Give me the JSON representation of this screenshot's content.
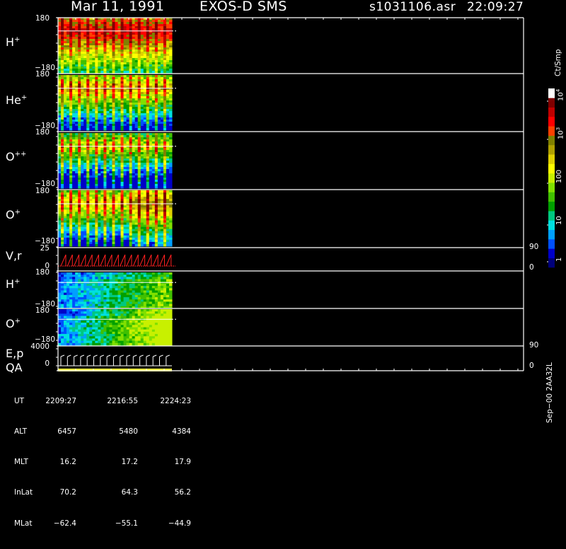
{
  "header": {
    "date": "Mar 11, 1991",
    "instrument": "EXOS-D SMS",
    "filename": "s1031106.asr",
    "time": "22:09:27"
  },
  "panels": [
    {
      "label": "H",
      "sup": "+",
      "top_tick": "180",
      "bottom_tick": "−180"
    },
    {
      "label": "He",
      "sup": "+",
      "top_tick": "180",
      "bottom_tick": "−180"
    },
    {
      "label": "O",
      "sup": "++",
      "top_tick": "180",
      "bottom_tick": "−180"
    },
    {
      "label": "O",
      "sup": "+",
      "top_tick": "180",
      "bottom_tick": "−180"
    }
  ],
  "vr_panel": {
    "label": "V,r",
    "top_tick": "25",
    "bottom_tick": "0",
    "right_top": "90",
    "right_bottom": "0"
  },
  "lower_panels": [
    {
      "label": "H",
      "sup": "+",
      "top_tick": "180",
      "bottom_tick": "−180"
    },
    {
      "label": "O",
      "sup": "+",
      "top_tick": "180",
      "bottom_tick": "−180"
    }
  ],
  "ep_panel": {
    "label1": "E,p",
    "label2": "QA",
    "top_tick": "4000",
    "bottom_tick": "0",
    "right_top": "90",
    "right_bottom": "0"
  },
  "colorbar": {
    "unit": "Ct/Smp",
    "ticks": [
      "1",
      "10",
      "100",
      "10",
      "10"
    ],
    "tick_exps": [
      "",
      "",
      "",
      "3",
      "4"
    ],
    "colors": [
      "#00007a",
      "#0000c8",
      "#0050ff",
      "#00a0ff",
      "#00e0e0",
      "#00c880",
      "#00a000",
      "#40c000",
      "#80e000",
      "#c8f000",
      "#ffff00",
      "#e0d000",
      "#b0a000",
      "#808000",
      "#ff4000",
      "#ff0000",
      "#c00000",
      "#800000",
      "#ffffff"
    ]
  },
  "footer": {
    "labels": [
      "UT",
      "ALT",
      "MLT",
      "InLat",
      "MLat"
    ],
    "columns": [
      [
        "2209:27",
        "6457",
        "16.2",
        "70.2",
        "−62.4"
      ],
      [
        "2216:55",
        "5480",
        "17.2",
        "64.3",
        "−55.1"
      ],
      [
        "2224:23",
        "4384",
        "17.9",
        "56.2",
        "−44.9"
      ]
    ],
    "stamp": "Sep−00  2AA32L"
  },
  "chart_data": {
    "type": "heatmap",
    "title": "Mar 11, 1991   EXOS-D SMS",
    "xlabel": "UT",
    "x_ticks": [
      "2209:27",
      "2216:55",
      "2224:23"
    ],
    "y_range": [
      -180,
      180
    ],
    "colorbar_unit": "Ct/Smp",
    "colorbar_scale": "log",
    "colorbar_range": [
      1,
      10000
    ],
    "series": [
      {
        "name": "H+"
      },
      {
        "name": "He+"
      },
      {
        "name": "O++"
      },
      {
        "name": "O+"
      }
    ]
  }
}
